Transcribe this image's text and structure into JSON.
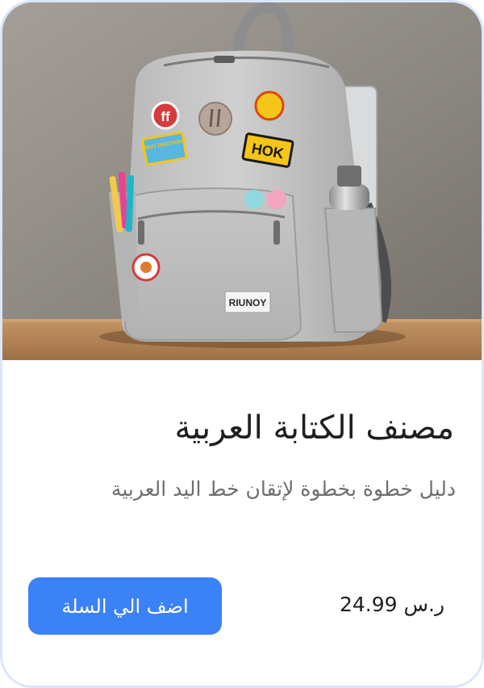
{
  "product": {
    "image_alt": "Gray backpack with patches",
    "patch_texts": [
      "ff",
      "$ BUY DISCOUNT!",
      "HOK",
      "RIUNOY"
    ],
    "title": "مصنف الكتابة العربية",
    "description": "دليل خطوة بخطوة لإتقان خط اليد العربية",
    "price": "24.99 ر.س",
    "add_to_cart_label": "اضف الي السلة"
  },
  "colors": {
    "accent": "#3b82f6",
    "card_border": "#dbe6fb",
    "title_text": "#1f1f1f",
    "subtitle_text": "#6e6e6e"
  }
}
